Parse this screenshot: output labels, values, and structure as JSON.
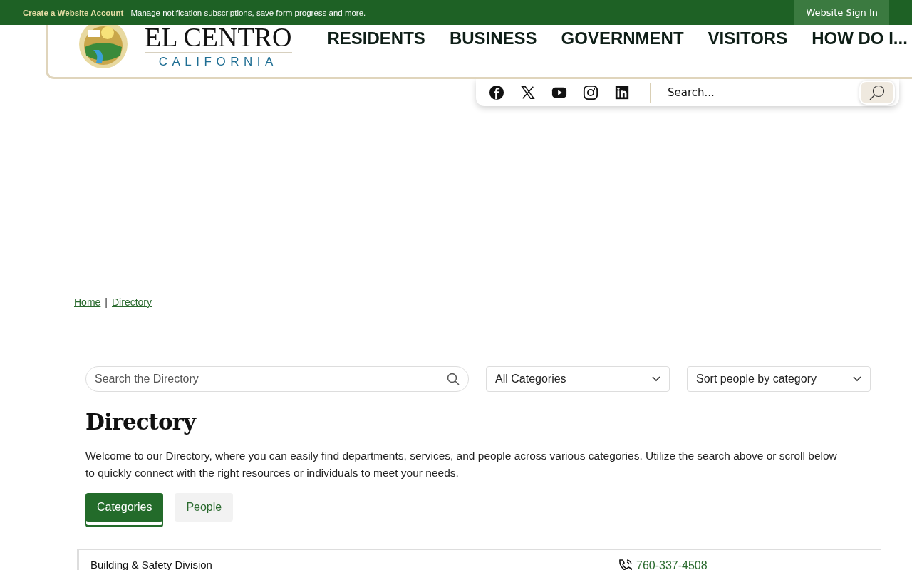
{
  "top_bar": {
    "account_link": "Create a Website Account",
    "account_text": " - Manage notification subscriptions, save form progress and more.",
    "sign_in": "Website Sign In"
  },
  "header": {
    "logo_title": "EL CENTRO",
    "logo_subtitle": "CALIFORNIA",
    "nav": [
      "RESIDENTS",
      "BUSINESS",
      "GOVERNMENT",
      "VISITORS",
      "HOW DO I..."
    ]
  },
  "site_search": {
    "placeholder": "Search..."
  },
  "breadcrumb": [
    {
      "label": "Home"
    },
    {
      "label": "Directory"
    }
  ],
  "breadcrumb_separator": "|",
  "directory": {
    "search_placeholder": "Search the Directory",
    "category_select": "All Categories",
    "sort_select": "Sort people by category",
    "title": "Directory",
    "intro": "Welcome to our Directory, where you can easily find departments, services, and people across various categories. Utilize the search above or scroll below to quickly connect with the right resources or individuals to meet your needs.",
    "tabs": [
      {
        "label": "Categories",
        "selected": true
      },
      {
        "label": "People",
        "selected": false
      }
    ],
    "rows": [
      {
        "name": "Building & Safety Division",
        "phone": "760-337-4508"
      }
    ]
  }
}
